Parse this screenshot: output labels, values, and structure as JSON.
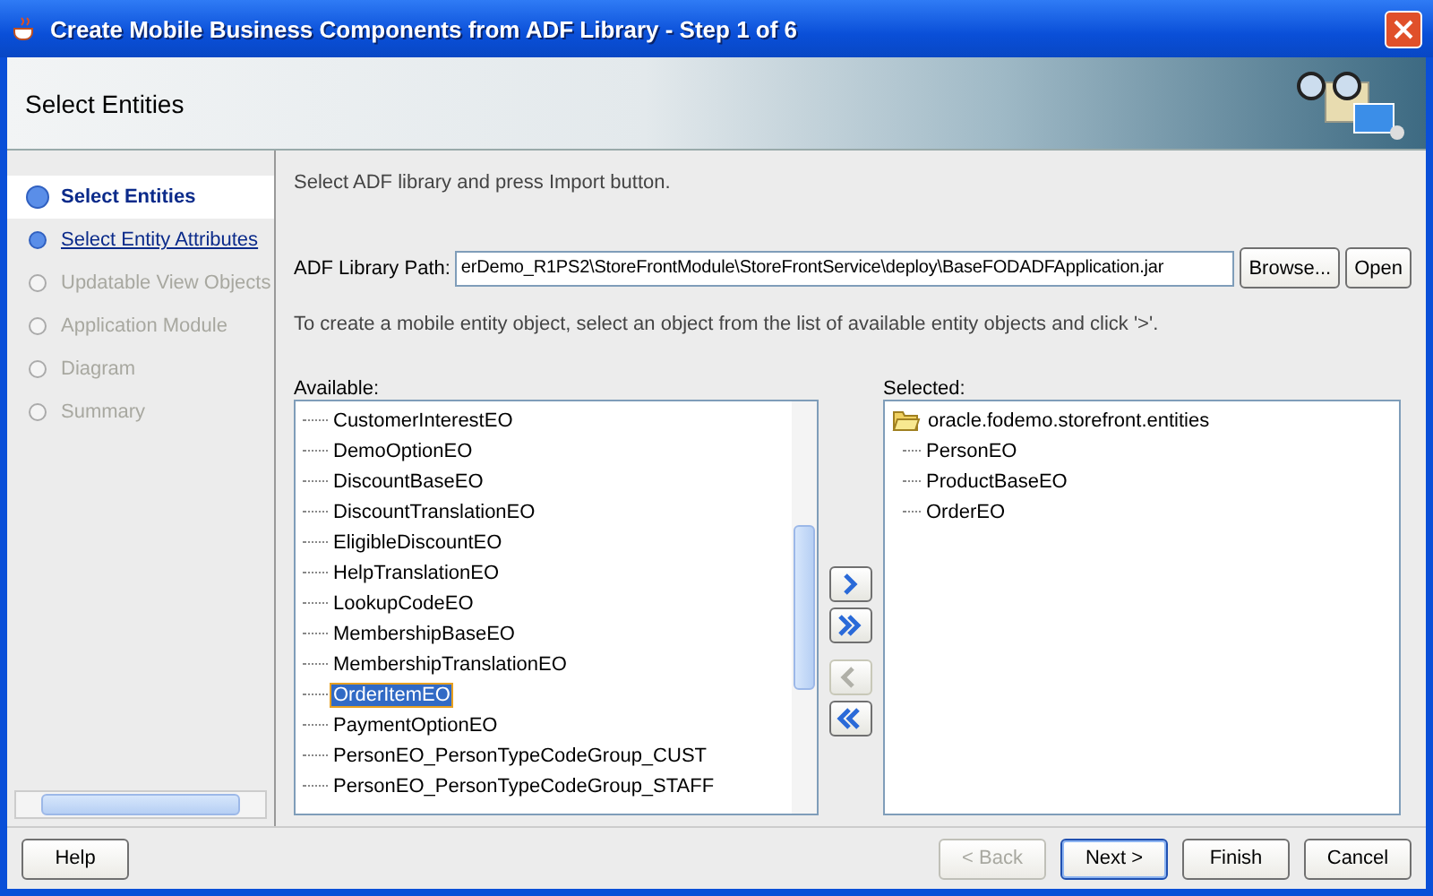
{
  "window": {
    "title": "Create Mobile Business Components from ADF Library - Step 1 of 6"
  },
  "header": {
    "title": "Select Entities"
  },
  "steps": [
    {
      "label": "Select Entities",
      "selected": true,
      "disabled": false
    },
    {
      "label": "Select Entity Attributes",
      "selected": false,
      "disabled": false
    },
    {
      "label": "Updatable View Objects",
      "selected": false,
      "disabled": true
    },
    {
      "label": "Application Module",
      "selected": false,
      "disabled": true
    },
    {
      "label": "Diagram",
      "selected": false,
      "disabled": true
    },
    {
      "label": "Summary",
      "selected": false,
      "disabled": true
    }
  ],
  "intro": "Select ADF library and press Import button.",
  "path": {
    "label": "ADF Library Path:",
    "value": "erDemo_R1PS2\\StoreFrontModule\\StoreFrontService\\deploy\\BaseFODADFApplication.jar",
    "browse": "Browse...",
    "open": "Open"
  },
  "instruction": "To create a mobile entity object, select an object from the list of available entity objects and click '>'.",
  "available": {
    "label": "Available:",
    "items": [
      {
        "label": "CustomerInterestEO",
        "selected": false
      },
      {
        "label": "DemoOptionEO",
        "selected": false
      },
      {
        "label": "DiscountBaseEO",
        "selected": false
      },
      {
        "label": "DiscountTranslationEO",
        "selected": false
      },
      {
        "label": "EligibleDiscountEO",
        "selected": false
      },
      {
        "label": "HelpTranslationEO",
        "selected": false
      },
      {
        "label": "LookupCodeEO",
        "selected": false
      },
      {
        "label": "MembershipBaseEO",
        "selected": false
      },
      {
        "label": "MembershipTranslationEO",
        "selected": false
      },
      {
        "label": "OrderItemEO",
        "selected": true
      },
      {
        "label": "PaymentOptionEO",
        "selected": false
      },
      {
        "label": "PersonEO_PersonTypeCodeGroup_CUST",
        "selected": false
      },
      {
        "label": "PersonEO_PersonTypeCodeGroup_STAFF",
        "selected": false
      }
    ]
  },
  "shuttle": [
    {
      "kind": "right",
      "disabled": false
    },
    {
      "kind": "all-right",
      "disabled": false
    },
    {
      "kind": "left",
      "disabled": true
    },
    {
      "kind": "all-left",
      "disabled": false
    }
  ],
  "selected": {
    "label": "Selected:",
    "root": "oracle.fodemo.storefront.entities",
    "children": [
      {
        "label": "PersonEO"
      },
      {
        "label": "ProductBaseEO"
      },
      {
        "label": "OrderEO"
      }
    ]
  },
  "buttons": {
    "help": {
      "label": "Help"
    },
    "nav": [
      {
        "label": "< Back",
        "disabled": true
      },
      {
        "label": "Next >",
        "disabled": false
      },
      {
        "label": "Finish",
        "disabled": false
      },
      {
        "label": "Cancel",
        "disabled": false
      }
    ]
  }
}
